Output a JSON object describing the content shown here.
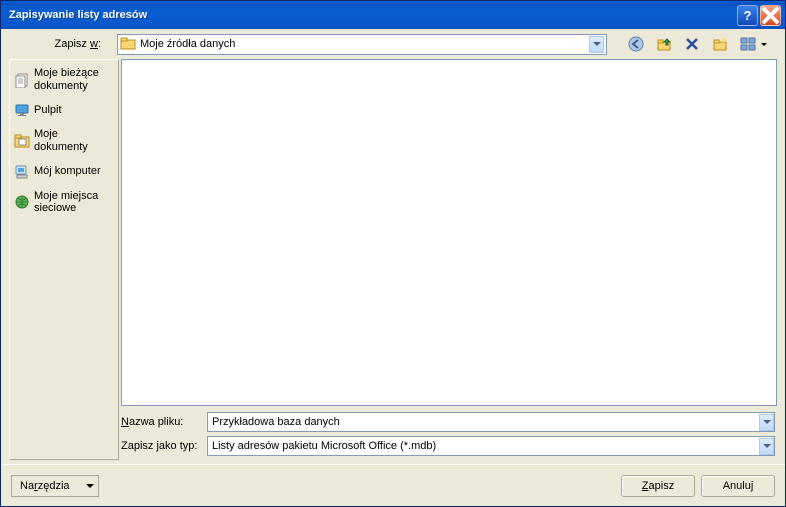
{
  "title": "Zapisywanie listy adresów",
  "savein": {
    "label_pre": "Zapisz ",
    "label_u": "w",
    "label_post": ":",
    "value": "Moje źródła danych"
  },
  "places": [
    {
      "id": "recent",
      "label": "Moje bieżące dokumenty"
    },
    {
      "id": "desktop",
      "label": "Pulpit"
    },
    {
      "id": "mydocs",
      "label": "Moje dokumenty"
    },
    {
      "id": "mycomp",
      "label": "Mój komputer"
    },
    {
      "id": "network",
      "label": "Moje miejsca sieciowe"
    }
  ],
  "filename": {
    "label_pre": "",
    "label_u": "N",
    "label_post": "azwa pliku:",
    "value": "Przykładowa baza danych"
  },
  "filetype": {
    "label": "Zapisz jako typ:",
    "value": "Listy adresów pakietu Microsoft Office (*.mdb)"
  },
  "tools": {
    "label_pre": "Na",
    "label_u": "r",
    "label_post": "zędzia"
  },
  "save_btn": {
    "pre": "",
    "u": "Z",
    "post": "apisz"
  },
  "cancel_btn": "Anuluj"
}
